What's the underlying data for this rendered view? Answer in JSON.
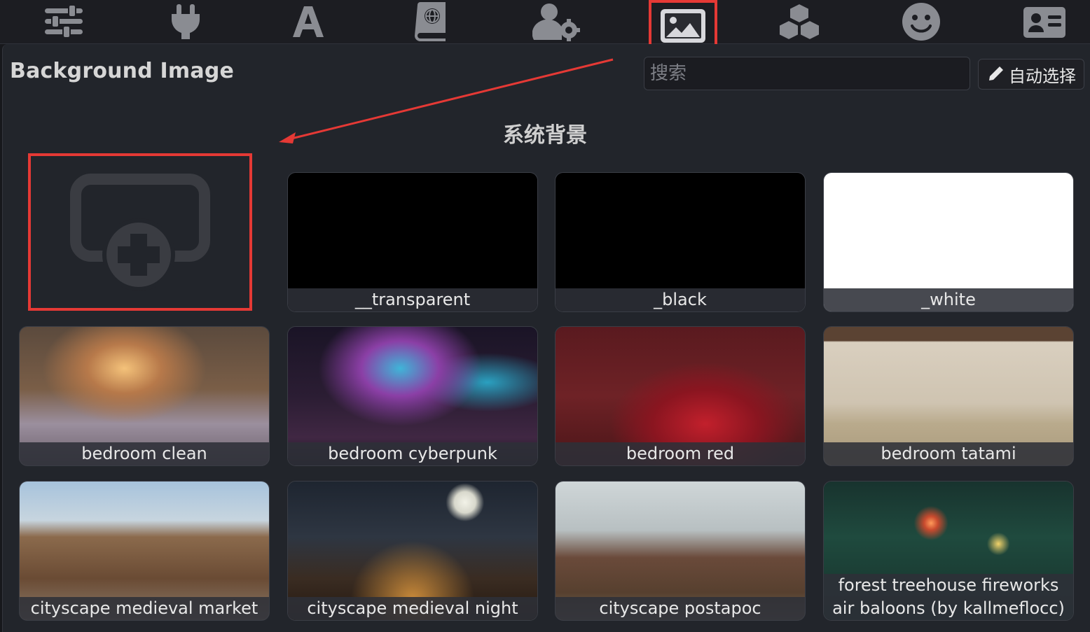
{
  "nav": {
    "tabs": [
      {
        "name": "sliders-icon",
        "active": false
      },
      {
        "name": "plug-icon",
        "active": false
      },
      {
        "name": "font-a-icon",
        "active": false
      },
      {
        "name": "globe-book-icon",
        "active": false
      },
      {
        "name": "user-settings-icon",
        "active": false
      },
      {
        "name": "image-icon",
        "active": true
      },
      {
        "name": "cubes-icon",
        "active": false
      },
      {
        "name": "smiley-icon",
        "active": false
      },
      {
        "name": "id-card-icon",
        "active": false
      }
    ]
  },
  "header": {
    "title": "Background Image",
    "search_placeholder": "搜索",
    "auto_select_label": "自动选择"
  },
  "section": {
    "title": "系统背景"
  },
  "add_tile": {
    "icon": "add-image-icon"
  },
  "backgrounds": [
    {
      "label": "__transparent",
      "thumb": "black"
    },
    {
      "label": "_black",
      "thumb": "black"
    },
    {
      "label": "_white",
      "thumb": "white"
    },
    {
      "label": "bedroom clean",
      "thumb": "bedroom-clean"
    },
    {
      "label": "bedroom cyberpunk",
      "thumb": "bedroom-cyberpunk"
    },
    {
      "label": "bedroom red",
      "thumb": "bedroom-red"
    },
    {
      "label": "bedroom tatami",
      "thumb": "bedroom-tatami"
    },
    {
      "label": "cityscape medieval market",
      "thumb": "medieval-market"
    },
    {
      "label": "cityscape medieval night",
      "thumb": "medieval-night"
    },
    {
      "label": "cityscape postapoc",
      "thumb": "postapoc"
    },
    {
      "label": "forest treehouse fireworks air baloons (by kallmeflocc)",
      "thumb": "forest-fireworks"
    }
  ],
  "colors": {
    "highlight": "#e53935",
    "icon": "#8a8c92",
    "panel": "#22252b"
  }
}
